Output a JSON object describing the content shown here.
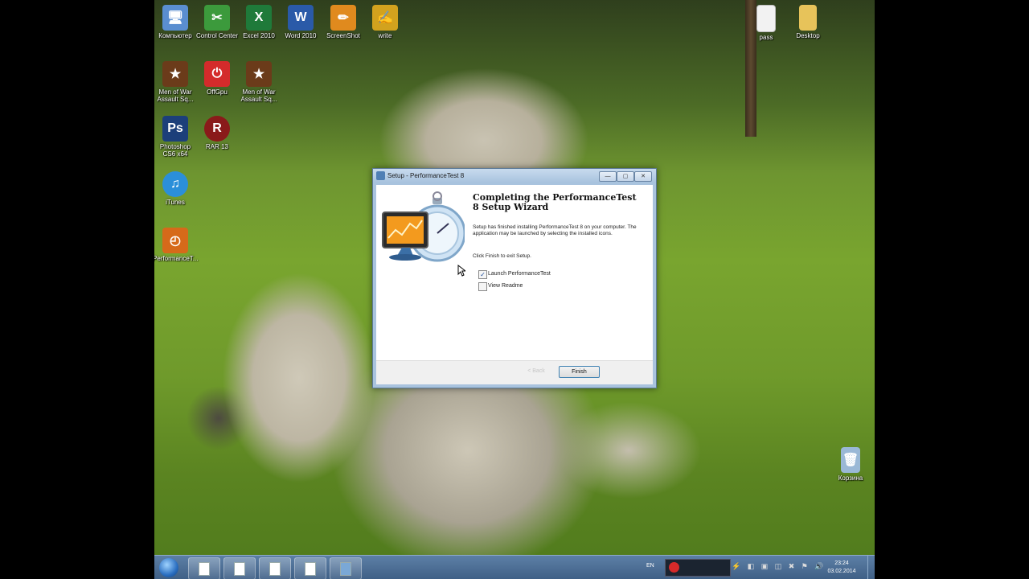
{
  "desktop": {
    "icons": [
      {
        "label": "Компьютер",
        "glyph": "🖥",
        "color": "#5a8ed0"
      },
      {
        "label": "Control Center",
        "glyph": "✂",
        "color": "#3c9a3c"
      },
      {
        "label": "Excel 2010",
        "glyph": "X",
        "color": "#1f7a3a"
      },
      {
        "label": "Word 2010",
        "glyph": "W",
        "color": "#2a5aa8"
      },
      {
        "label": "ScreenShot",
        "glyph": "✏",
        "color": "#e08a1e"
      },
      {
        "label": "write",
        "glyph": "✍",
        "color": "#d2a21e"
      },
      {
        "label": "Men of War Assault Sq...",
        "glyph": "★",
        "color": "#6b3b1a"
      },
      {
        "label": "OffGpu",
        "glyph": "⏻",
        "color": "#d42b2b"
      },
      {
        "label": "Men of War Assault Sq...",
        "glyph": "★",
        "color": "#6b3b1a"
      },
      {
        "label": "Photoshop CS6 x64",
        "glyph": "Ps",
        "color": "#1c3f7a"
      },
      {
        "label": "RAR 13",
        "glyph": "R",
        "color": "#8a1a1a"
      },
      {
        "label": "iTunes",
        "glyph": "♫",
        "color": "#2b8fd9"
      },
      {
        "label": "PerformanceT...",
        "glyph": "◴",
        "color": "#d66a1a"
      },
      {
        "label": "pass",
        "glyph": "",
        "color": "#f2f2f2"
      },
      {
        "label": "Desktop",
        "glyph": "",
        "color": "#e7c35a"
      },
      {
        "label": "Корзина",
        "glyph": "🗑",
        "color": "#9ab8d6"
      }
    ]
  },
  "dialog": {
    "title": "Setup - PerformanceTest 8",
    "heading": "Completing the PerformanceTest 8 Setup Wizard",
    "body1": "Setup has finished installing PerformanceTest 8 on your computer. The application may be launched by selecting the installed icons.",
    "body2": "Click Finish to exit Setup.",
    "checkbox_launch": {
      "label": "Launch PerformanceTest",
      "checked": true
    },
    "checkbox_readme": {
      "label": "View Readme",
      "checked": false
    },
    "finish_label": "Finish",
    "ghost_label": "< Back",
    "btn_min": "—",
    "btn_max": "▢",
    "btn_close": "✕",
    "check_mark": "✓"
  },
  "taskbar": {
    "lang": "EN",
    "time": "23:24",
    "date": "03.02.2014",
    "tray_glyphs": "⚡ ◧ ▣ ◫ ✖ ⚑ 🔊"
  }
}
